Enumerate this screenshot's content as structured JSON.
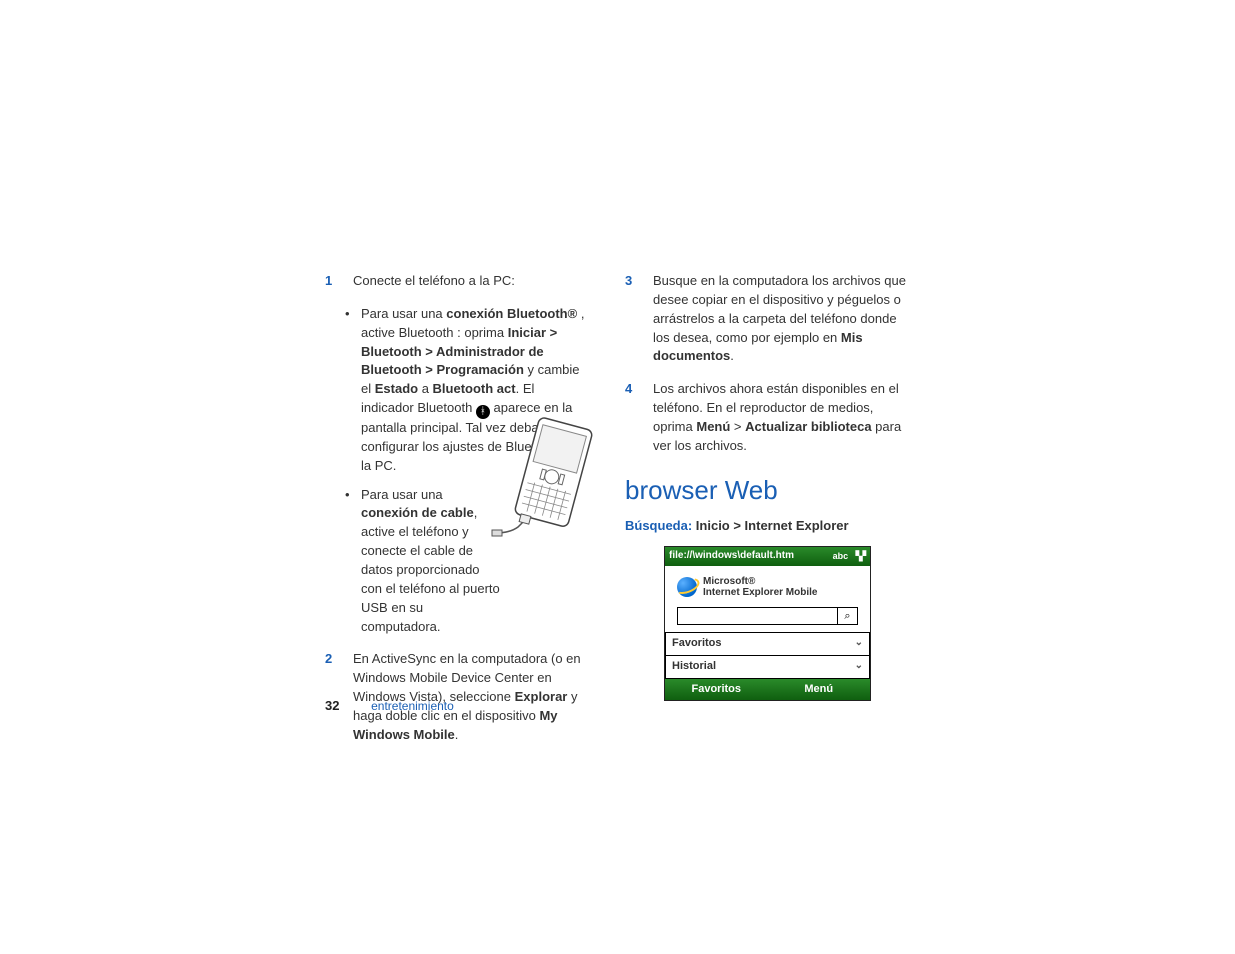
{
  "left": {
    "step1": {
      "num": "1",
      "intro": "Conecte el teléfono a la PC:",
      "bullet1_prefix": "Para usar una ",
      "bullet1_bold": "conexión Bluetooth®",
      "bullet1_mid": " , active Bluetooth : oprima ",
      "bullet1_path": "Iniciar > Bluetooth > Administrador de Bluetooth > Programación",
      "bullet1_mid2": " y cambie el ",
      "bullet1_estado": "Estado",
      "bullet1_mid3": " a ",
      "bullet1_btact": "Bluetooth act",
      "bullet1_mid4": ". El indicador Bluetooth ",
      "bullet1_tail": " aparece en la pantalla principal. Tal vez deba configurar los ajustes de Bluetooth en la PC.",
      "bullet2_prefix": "Para usar una ",
      "bullet2_bold": "conexión de cable",
      "bullet2_tail": ", active el teléfono y conecte el cable de datos proporcionado con el teléfono al puerto USB en su computadora."
    },
    "step2": {
      "num": "2",
      "pre": "En ActiveSync en la computadora (o en Windows Mobile Device Center en Windows Vista), seleccione ",
      "explorar": "Explorar",
      "mid": " y haga doble clic en el dispositivo ",
      "mwm": "My Windows Mobile",
      "dot": "."
    }
  },
  "right": {
    "step3": {
      "num": "3",
      "pre": "Busque en la computadora los archivos que desee copiar en el dispositivo y péguelos o arrástrelos a la carpeta del teléfono donde los desea, como por ejemplo en ",
      "misdoc": "Mis documentos",
      "dot": "."
    },
    "step4": {
      "num": "4",
      "pre": "Los archivos ahora están disponibles en el teléfono. En el reproductor de medios, oprima ",
      "menu": "Menú",
      "gt": " > ",
      "update": "Actualizar biblioteca",
      "tail": " para ver los archivos."
    },
    "heading": "browser Web",
    "search_lbl": "Búsqueda:",
    "search_path": "Inicio > Internet Explorer",
    "ie": {
      "url": "file://\\windows\\default.htm",
      "brand1": "Microsoft®",
      "brand2": "Internet Explorer Mobile",
      "fav": "Favoritos",
      "hist": "Historial",
      "soft_left": "Favoritos",
      "soft_right": "Menú"
    }
  },
  "footer": {
    "page": "32",
    "section": "entretenimiento"
  }
}
